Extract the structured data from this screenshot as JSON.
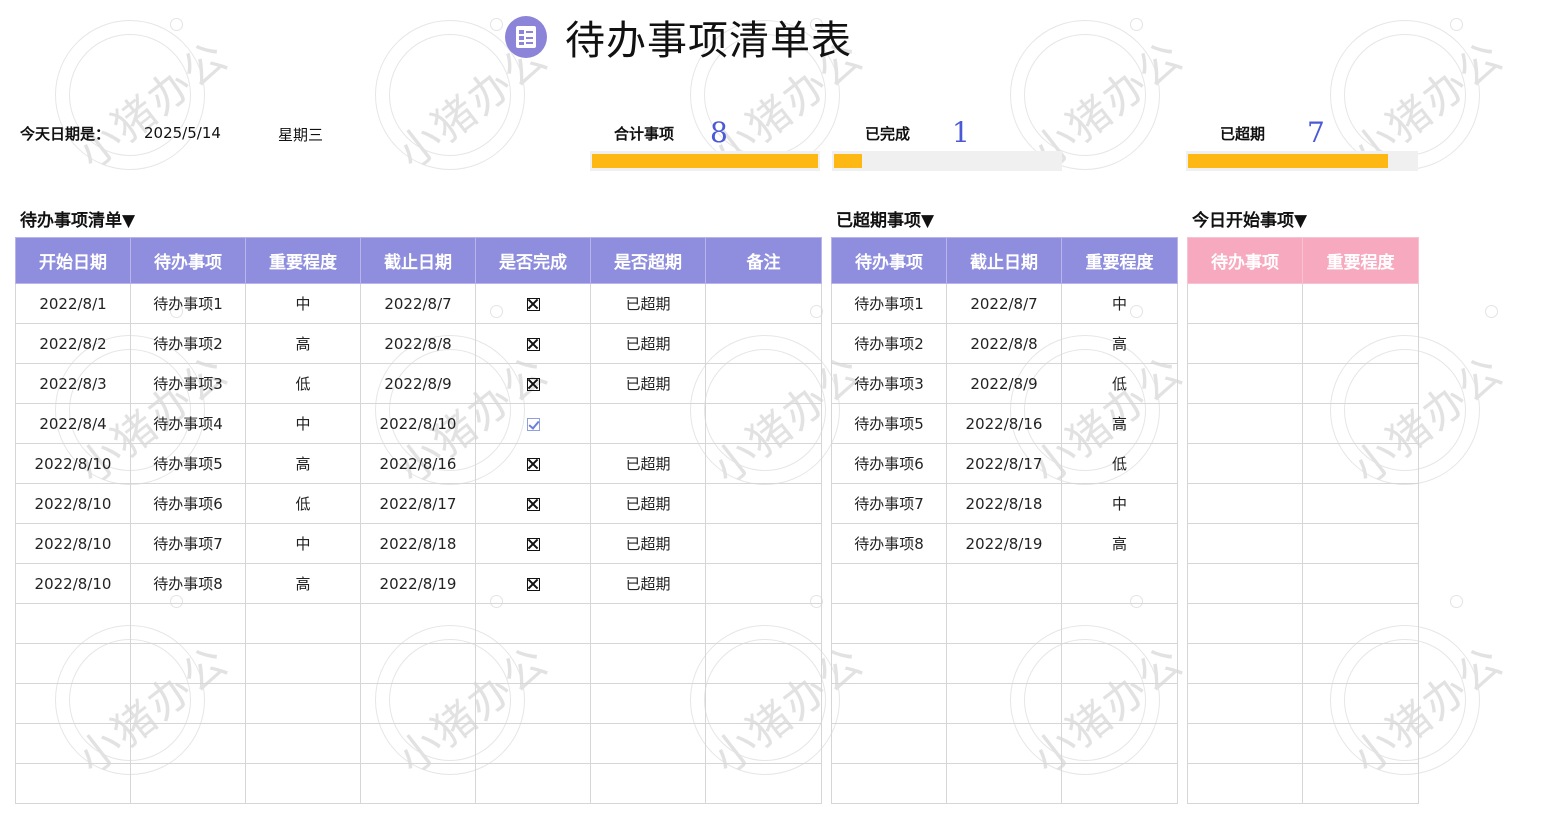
{
  "title": "待办事项清单表",
  "watermark": "小猪办公",
  "colors": {
    "header_purple": "#8f8ede",
    "header_pink": "#f7aabf",
    "bar_fill": "#fdb813",
    "number_blue": "#4a5ad6"
  },
  "date_info": {
    "label": "今天日期是：",
    "date": "2025/5/14",
    "weekday": "星期三"
  },
  "summary": {
    "total": {
      "label": "合计事项",
      "value": "8",
      "fraction": 1.0
    },
    "done": {
      "label": "已完成",
      "value": "1",
      "fraction": 0.125
    },
    "overdue": {
      "label": "已超期",
      "value": "7",
      "fraction": 0.875
    }
  },
  "todo": {
    "heading": "待办事项清单▼",
    "headers": [
      "开始日期",
      "待办事项",
      "重要程度",
      "截止日期",
      "是否完成",
      "是否超期",
      "备注"
    ],
    "rows": [
      [
        "2022/8/1",
        "待办事项1",
        "中",
        "2022/8/7",
        "x",
        "已超期",
        ""
      ],
      [
        "2022/8/2",
        "待办事项2",
        "高",
        "2022/8/8",
        "x",
        "已超期",
        ""
      ],
      [
        "2022/8/3",
        "待办事项3",
        "低",
        "2022/8/9",
        "x",
        "已超期",
        ""
      ],
      [
        "2022/8/4",
        "待办事项4",
        "中",
        "2022/8/10",
        "v",
        "",
        ""
      ],
      [
        "2022/8/10",
        "待办事项5",
        "高",
        "2022/8/16",
        "x",
        "已超期",
        ""
      ],
      [
        "2022/8/10",
        "待办事项6",
        "低",
        "2022/8/17",
        "x",
        "已超期",
        ""
      ],
      [
        "2022/8/10",
        "待办事项7",
        "中",
        "2022/8/18",
        "x",
        "已超期",
        ""
      ],
      [
        "2022/8/10",
        "待办事项8",
        "高",
        "2022/8/19",
        "x",
        "已超期",
        ""
      ]
    ],
    "empty_rows": 5
  },
  "overdue_list": {
    "heading": "已超期事项▼",
    "headers": [
      "待办事项",
      "截止日期",
      "重要程度"
    ],
    "rows": [
      [
        "待办事项1",
        "2022/8/7",
        "中"
      ],
      [
        "待办事项2",
        "2022/8/8",
        "高"
      ],
      [
        "待办事项3",
        "2022/8/9",
        "低"
      ],
      [
        "待办事项5",
        "2022/8/16",
        "高"
      ],
      [
        "待办事项6",
        "2022/8/17",
        "低"
      ],
      [
        "待办事项7",
        "2022/8/18",
        "中"
      ],
      [
        "待办事项8",
        "2022/8/19",
        "高"
      ]
    ],
    "empty_rows": 6
  },
  "today_list": {
    "heading": "今日开始事项▼",
    "headers": [
      "待办事项",
      "重要程度"
    ],
    "rows": [],
    "empty_rows": 13
  }
}
